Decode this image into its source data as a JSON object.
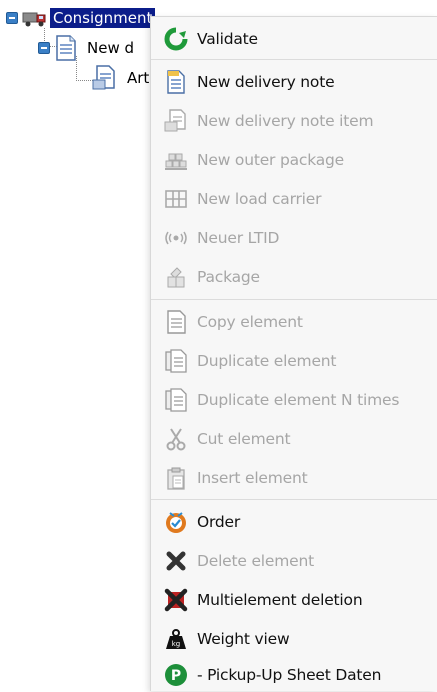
{
  "tree": {
    "root_label": "Consignment",
    "child_label": "New d",
    "grandchild_label": "Art"
  },
  "menu": {
    "items": [
      {
        "label": "Validate",
        "icon": "validate-icon",
        "enabled": true
      },
      {
        "label": "New delivery note",
        "icon": "delivery-note-icon",
        "enabled": true
      },
      {
        "label": "New delivery note item",
        "icon": "delivery-note-item-icon",
        "enabled": false
      },
      {
        "label": "New outer package",
        "icon": "outer-package-icon",
        "enabled": false
      },
      {
        "label": "New load carrier",
        "icon": "load-carrier-icon",
        "enabled": false
      },
      {
        "label": "Neuer LTID",
        "icon": "ltid-icon",
        "enabled": false
      },
      {
        "label": "Package",
        "icon": "package-icon",
        "enabled": false
      },
      {
        "label": "Copy element",
        "icon": "copy-icon",
        "enabled": false
      },
      {
        "label": "Duplicate element",
        "icon": "duplicate-icon",
        "enabled": false
      },
      {
        "label": "Duplicate element N times",
        "icon": "duplicate-n-icon",
        "enabled": false
      },
      {
        "label": "Cut element",
        "icon": "scissors-icon",
        "enabled": false
      },
      {
        "label": "Insert element",
        "icon": "paste-icon",
        "enabled": false
      },
      {
        "label": "Order",
        "icon": "order-icon",
        "enabled": true
      },
      {
        "label": "Delete element",
        "icon": "delete-icon",
        "enabled": false
      },
      {
        "label": "Multielement deletion",
        "icon": "multi-delete-icon",
        "enabled": true
      },
      {
        "label": "Weight view",
        "icon": "weight-icon",
        "enabled": true
      },
      {
        "label": "- Pickup-Up Sheet Daten",
        "icon": "pickup-sheet-icon",
        "enabled": true
      }
    ]
  },
  "colors": {
    "selection_bg": "#0b1d8a",
    "enabled_text": "#111111",
    "disabled_text": "#a6a6a6",
    "validate_green": "#1f9a3a",
    "order_orange": "#e07a1f",
    "pickup_green": "#1d8f3a"
  }
}
